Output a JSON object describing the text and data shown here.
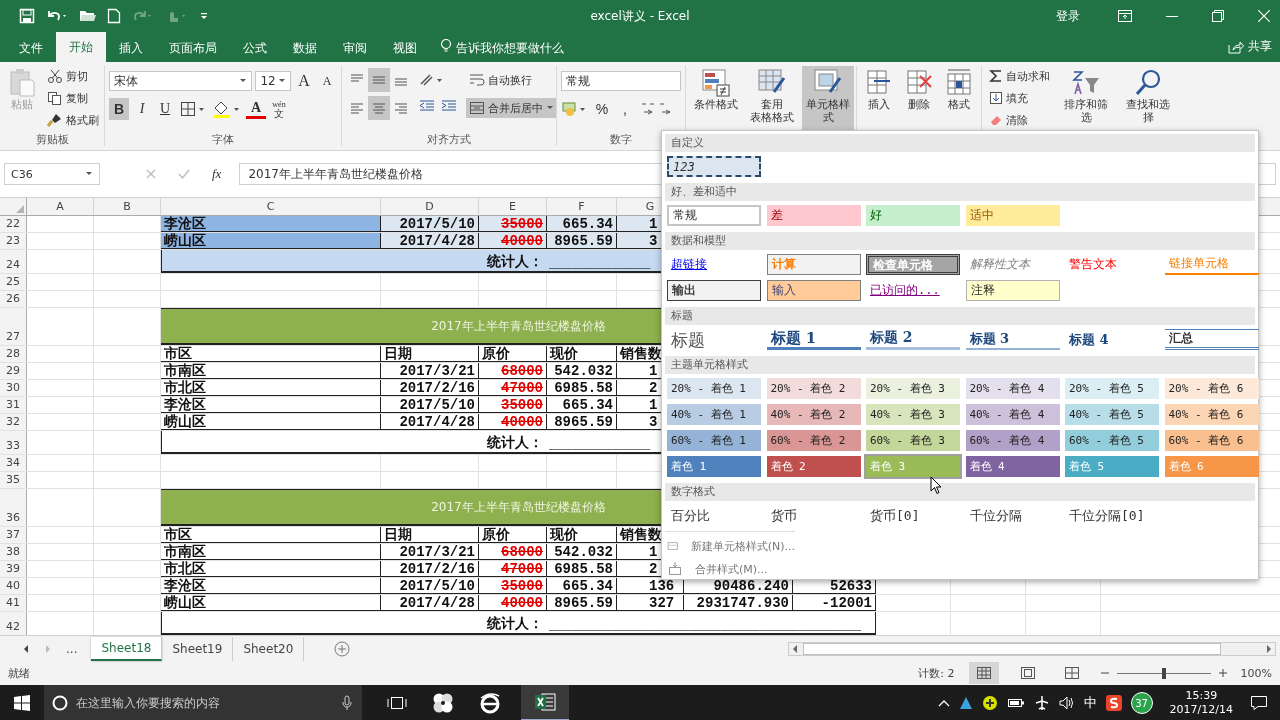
{
  "window": {
    "title": "excel讲义 - Excel",
    "sign_in": "登录",
    "share": "共享"
  },
  "ribbon_tabs": [
    {
      "label": "文件",
      "selected": false
    },
    {
      "label": "开始",
      "selected": true
    },
    {
      "label": "插入",
      "selected": false
    },
    {
      "label": "页面布局",
      "selected": false
    },
    {
      "label": "公式",
      "selected": false
    },
    {
      "label": "数据",
      "selected": false
    },
    {
      "label": "审阅",
      "selected": false
    },
    {
      "label": "视图",
      "selected": false
    }
  ],
  "tell_me": "告诉我你想要做什么",
  "ribbon": {
    "clipboard": {
      "paste": "粘贴",
      "paste_disabled": true,
      "cut": "剪切",
      "copy": "复制",
      "format_painter": "格式刷",
      "group": "剪贴板"
    },
    "font": {
      "name": "宋体",
      "size": "12",
      "grow": "A",
      "shrink": "A",
      "bold": {
        "label": "B",
        "pressed": true
      },
      "italic": {
        "label": "I",
        "pressed": false
      },
      "underline": {
        "label": "U",
        "pressed": false
      },
      "font_color": "A",
      "phonetic_top": "wén",
      "phonetic_bottom": "文",
      "group": "字体"
    },
    "alignment": {
      "wrap": "自动换行",
      "merge": {
        "label": "合并后居中",
        "pressed": true
      },
      "buttons": [
        {
          "kind": "top",
          "pressed": false
        },
        {
          "kind": "middle",
          "pressed": true
        },
        {
          "kind": "bottom",
          "pressed": false
        },
        {
          "kind": "left",
          "pressed": false
        },
        {
          "kind": "center",
          "pressed": true
        },
        {
          "kind": "right",
          "pressed": false
        }
      ],
      "group": "对齐方式"
    },
    "number": {
      "format": "常规",
      "percent": "%",
      "comma": ",",
      "group": "数字"
    },
    "styles": [
      {
        "kind": "conditional",
        "label": "条件格式",
        "pressed": false
      },
      {
        "kind": "table",
        "label": "套用",
        "label2": "表格格式",
        "pressed": false
      },
      {
        "kind": "cell",
        "label": "单元格样式",
        "pressed": true
      }
    ],
    "cells": [
      {
        "kind": "insert",
        "label": "插入"
      },
      {
        "kind": "delete",
        "label": "删除"
      },
      {
        "kind": "format",
        "label": "格式"
      }
    ],
    "editing": {
      "autosum": "自动求和",
      "fill": "填充",
      "clear": "清除",
      "sort": "排序和筛选",
      "find": "查找和选择"
    }
  },
  "name_box": "C36",
  "function_label": "fx",
  "formula": "2017年上半年青岛世纪楼盘价格",
  "columns": [
    "A",
    "B",
    "C",
    "D",
    "E",
    "F",
    "G"
  ],
  "rows": [
    {
      "number": "22",
      "kind": "data",
      "banded": true,
      "cells": [
        "李沧区",
        "2017/5/10",
        "35000",
        "665.34",
        "1"
      ]
    },
    {
      "number": "23",
      "kind": "data",
      "banded": true,
      "cells": [
        "崂山区",
        "2017/4/28",
        "40000",
        "8965.59",
        "3"
      ]
    },
    {
      "number": "24",
      "kind": "signature",
      "banded": true,
      "label": "统计人：",
      "line": "_____________"
    },
    {
      "number": "25",
      "kind": "empty"
    },
    {
      "number": "26",
      "kind": "empty"
    },
    {
      "number": "27",
      "kind": "title",
      "text": "2017年上半年青岛世纪楼盘价格"
    },
    {
      "number": "28",
      "kind": "header",
      "banded": false,
      "cells": [
        "市区",
        "日期",
        "原价",
        "现价",
        "销售数"
      ]
    },
    {
      "number": "29",
      "kind": "data",
      "banded": false,
      "cells": [
        "市南区",
        "2017/3/21",
        "68000",
        "542.032",
        "1"
      ]
    },
    {
      "number": "30",
      "kind": "data",
      "banded": false,
      "cells": [
        "市北区",
        "2017/2/16",
        "47000",
        "6985.58",
        "2"
      ]
    },
    {
      "number": "31",
      "kind": "data",
      "banded": false,
      "cells": [
        "李沧区",
        "2017/5/10",
        "35000",
        "665.34",
        "1"
      ]
    },
    {
      "number": "32",
      "kind": "data",
      "banded": false,
      "cells": [
        "崂山区",
        "2017/4/28",
        "40000",
        "8965.59",
        "3"
      ]
    },
    {
      "number": "33",
      "kind": "signature",
      "banded": false,
      "label": "统计人：",
      "line": "_____________"
    },
    {
      "number": "34",
      "kind": "empty"
    },
    {
      "number": "35",
      "kind": "empty"
    },
    {
      "number": "36",
      "kind": "title",
      "text": "2017年上半年青岛世纪楼盘价格"
    },
    {
      "number": "37",
      "kind": "header",
      "banded": false,
      "cells": [
        "市区",
        "日期",
        "原价",
        "现价",
        "销售数"
      ]
    },
    {
      "number": "38",
      "kind": "data",
      "banded": false,
      "cells": [
        "市南区",
        "2017/3/21",
        "68000",
        "542.032",
        "1"
      ]
    },
    {
      "number": "39",
      "kind": "data",
      "banded": false,
      "cells": [
        "市北区",
        "2017/2/16",
        "47000",
        "6985.58",
        "2"
      ]
    },
    {
      "number": "40",
      "kind": "data",
      "banded": false,
      "cells": [
        "李沧区",
        "2017/5/10",
        "35000",
        "665.34",
        "136",
        "90486.240",
        "52633"
      ]
    },
    {
      "number": "41",
      "kind": "data",
      "banded": false,
      "cells": [
        "崂山区",
        "2017/4/28",
        "40000",
        "8965.59",
        "327",
        "2931747.930",
        "-12001"
      ]
    },
    {
      "number": "42",
      "kind": "signature",
      "banded": false,
      "label": "统计人：",
      "line": "________________________________________"
    }
  ],
  "styles_gallery": {
    "sections": [
      {
        "title": "自定义",
        "items": [
          {
            "label": "123",
            "kind": "custom"
          }
        ]
      },
      {
        "title": "好、差和适中",
        "items": [
          {
            "label": "常规",
            "kind": "normal"
          },
          {
            "label": "差",
            "kind": "bad"
          },
          {
            "label": "好",
            "kind": "good"
          },
          {
            "label": "适中",
            "kind": "neutral"
          }
        ]
      },
      {
        "title": "数据和模型",
        "items": [
          {
            "label": "超链接",
            "kind": "hyperlink"
          },
          {
            "label": "计算",
            "kind": "calculation"
          },
          {
            "label": "检查单元格",
            "kind": "check"
          },
          {
            "label": "解释性文本",
            "kind": "explanatory"
          },
          {
            "label": "警告文本",
            "kind": "warning"
          },
          {
            "label": "链接单元格",
            "kind": "linked"
          },
          {
            "label": "输出",
            "kind": "output"
          },
          {
            "label": "输入",
            "kind": "input"
          },
          {
            "label": "已访问的...",
            "kind": "followed"
          },
          {
            "label": "注释",
            "kind": "note"
          }
        ]
      },
      {
        "title": "标题",
        "items": [
          {
            "label": "标题",
            "kind": "title"
          },
          {
            "label": "标题 1",
            "kind": "heading1"
          },
          {
            "label": "标题 2",
            "kind": "heading2"
          },
          {
            "label": "标题 3",
            "kind": "heading3"
          },
          {
            "label": "标题 4",
            "kind": "heading4"
          },
          {
            "label": "汇总",
            "kind": "total"
          }
        ]
      },
      {
        "title": "主题单元格样式",
        "items": [
          {
            "label": "20% - 着色 1",
            "kind": "accent",
            "color": "#dce6f1",
            "hovered": false
          },
          {
            "label": "20% - 着色 2",
            "kind": "accent",
            "color": "#f2dcdb",
            "hovered": false
          },
          {
            "label": "20% - 着色 3",
            "kind": "accent",
            "color": "#ebf1de",
            "hovered": false
          },
          {
            "label": "20% - 着色 4",
            "kind": "accent",
            "color": "#e4dfec",
            "hovered": false
          },
          {
            "label": "20% - 着色 5",
            "kind": "accent",
            "color": "#daeef3",
            "hovered": false
          },
          {
            "label": "20% - 着色 6",
            "kind": "accent",
            "color": "#fde9d9",
            "hovered": false
          },
          {
            "label": "40% - 着色 1",
            "kind": "accent",
            "color": "#b8cce4",
            "hovered": false
          },
          {
            "label": "40% - 着色 2",
            "kind": "accent",
            "color": "#e6b8b7",
            "hovered": false
          },
          {
            "label": "40% - 着色 3",
            "kind": "accent",
            "color": "#d8e4bc",
            "hovered": false
          },
          {
            "label": "40% - 着色 4",
            "kind": "accent",
            "color": "#ccc0da",
            "hovered": false
          },
          {
            "label": "40% - 着色 5",
            "kind": "accent",
            "color": "#b7dee8",
            "hovered": false
          },
          {
            "label": "40% - 着色 6",
            "kind": "accent",
            "color": "#fcd5b4",
            "hovered": false
          },
          {
            "label": "60% - 着色 1",
            "kind": "accent",
            "color": "#95b3d7",
            "hovered": false
          },
          {
            "label": "60% - 着色 2",
            "kind": "accent",
            "color": "#da9694",
            "hovered": false
          },
          {
            "label": "60% - 着色 3",
            "kind": "accent",
            "color": "#c4d79b",
            "hovered": false
          },
          {
            "label": "60% - 着色 4",
            "kind": "accent",
            "color": "#b1a0c7",
            "hovered": false
          },
          {
            "label": "60% - 着色 5",
            "kind": "accent",
            "color": "#92cddc",
            "hovered": false
          },
          {
            "label": "60% - 着色 6",
            "kind": "accent",
            "color": "#fabf8f",
            "hovered": false
          },
          {
            "label": "着色 1",
            "kind": "accent_dark",
            "color": "#4f81bd",
            "hovered": false
          },
          {
            "label": "着色 2",
            "kind": "accent_dark",
            "color": "#c0504d",
            "hovered": false
          },
          {
            "label": "着色 3",
            "kind": "accent_dark",
            "color": "#9bbb59",
            "hovered": true
          },
          {
            "label": "着色 4",
            "kind": "accent_dark",
            "color": "#8064a2",
            "hovered": false
          },
          {
            "label": "着色 5",
            "kind": "accent_dark",
            "color": "#4bacc6",
            "hovered": false
          },
          {
            "label": "着色 6",
            "kind": "accent_dark",
            "color": "#f79646",
            "hovered": false
          }
        ]
      },
      {
        "title": "数字格式",
        "items": [
          {
            "label": "百分比",
            "kind": "plain"
          },
          {
            "label": "货币",
            "kind": "plain"
          },
          {
            "label": "货币[0]",
            "kind": "plain"
          },
          {
            "label": "千位分隔",
            "kind": "plain"
          },
          {
            "label": "千位分隔[0]",
            "kind": "plain"
          }
        ]
      }
    ],
    "menu": [
      {
        "label": "新建单元格样式(N)...",
        "kind": "new"
      },
      {
        "label": "合并样式(M)...",
        "kind": "merge"
      }
    ]
  },
  "sheet_nav_more": "...",
  "sheet_tabs": [
    {
      "label": "Sheet18",
      "selected": true
    },
    {
      "label": "Sheet19",
      "selected": false
    },
    {
      "label": "Sheet20",
      "selected": false
    }
  ],
  "status": {
    "ready": "就绪",
    "count": "计数: 2",
    "views": [
      {
        "kind": "normal",
        "selected": true
      },
      {
        "kind": "layout",
        "selected": false
      },
      {
        "kind": "break",
        "selected": false
      }
    ],
    "zoom": {
      "level": 0.5
    },
    "zoom_label": "100%"
  },
  "taskbar": {
    "search_placeholder": "在这里输入你要搜索的内容",
    "ime": "中",
    "badge": "37",
    "time": "15:39",
    "date": "2017/12/14"
  }
}
